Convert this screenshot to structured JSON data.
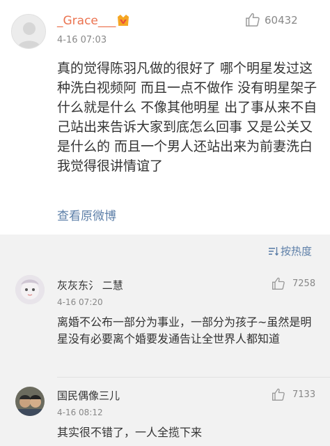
{
  "main_comment": {
    "username": "_Grace___",
    "time": "4-16 07:03",
    "like_count": "60432",
    "body": "真的觉得陈羽凡做的很好了 哪个明星发过这种洗白视频阿 而且一点不做作 没有明星架子 什么就是什么 不像其他明星 出了事从来不自己站出来告诉大家到底怎么回事 又是公关又是什么的 而且一个男人还站出来为前妻洗白 我觉得很讲情谊了",
    "view_weibo_label": "查看原微博",
    "icons": {
      "avatar": "default-avatar-icon",
      "badge": "vip-badge-icon",
      "like": "thumbs-up-icon"
    }
  },
  "replies_header": {
    "sort_label": "按热度",
    "sort_icon": "sort-icon"
  },
  "replies": [
    {
      "username": "灰灰东氵 二慧",
      "time": "4-16 07:20",
      "like_count": "7258",
      "text": "离婚不公布一部分为事业，一部分为孩子~虽然是明星没有必要离个婚要发通告让全世界人都知道"
    },
    {
      "username": "国民偶像三儿",
      "time": "4-16 08:12",
      "like_count": "7133",
      "text": "其实很不错了，一人全揽下来"
    }
  ],
  "colors": {
    "username_orange": "#eb7350",
    "link_blue": "#5d7fa8",
    "meta_gray": "#888888",
    "reply_bg": "#f2f2f2"
  }
}
